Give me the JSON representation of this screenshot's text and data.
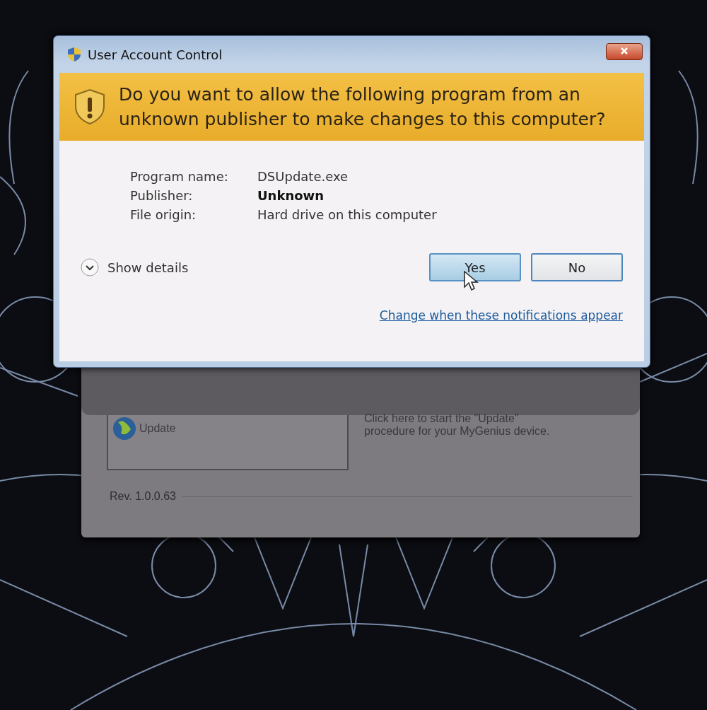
{
  "background_app": {
    "update_button": "Update",
    "description": "Click here to start the \"Update\" procedure for your MyGenius device.",
    "revision": "Rev. 1.0.0.63"
  },
  "dialog": {
    "title": "User Account Control",
    "question": "Do you want to allow the following program from an unknown publisher to make changes to this computer?",
    "details": [
      {
        "label": "Program name:",
        "value": "DSUpdate.exe",
        "emphasis": false
      },
      {
        "label": "Publisher:",
        "value": "Unknown",
        "emphasis": true
      },
      {
        "label": "File origin:",
        "value": "Hard drive on this computer",
        "emphasis": false
      }
    ],
    "show_details": {
      "label": "Show details",
      "expanded": false
    },
    "buttons": [
      {
        "label": "Yes",
        "highlighted": true
      },
      {
        "label": "No",
        "highlighted": false
      }
    ],
    "link": "Change when these notifications appear"
  }
}
